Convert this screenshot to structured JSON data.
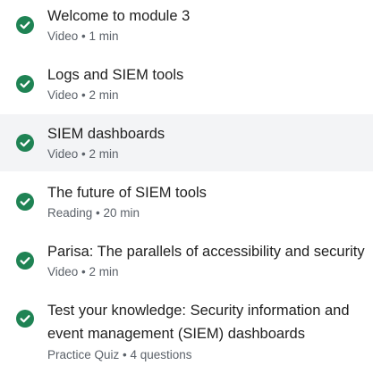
{
  "items": [
    {
      "title": "Welcome to module 3",
      "type": "Video",
      "duration": "1 min",
      "meta": "Video • 1 min",
      "completed": true,
      "active": false
    },
    {
      "title": "Logs and SIEM tools",
      "type": "Video",
      "duration": "2 min",
      "meta": "Video • 2 min",
      "completed": true,
      "active": false
    },
    {
      "title": "SIEM dashboards",
      "type": "Video",
      "duration": "2 min",
      "meta": "Video • 2 min",
      "completed": true,
      "active": true
    },
    {
      "title": "The future of SIEM tools",
      "type": "Reading",
      "duration": "20 min",
      "meta": "Reading • 20 min",
      "completed": true,
      "active": false
    },
    {
      "title": "Parisa: The parallels of accessibility and security",
      "type": "Video",
      "duration": "2 min",
      "meta": "Video • 2 min",
      "completed": true,
      "active": false
    },
    {
      "title": "Test your knowledge: Security information and event management (SIEM) dashboards",
      "type": "Practice Quiz",
      "duration": "4 questions",
      "meta": "Practice Quiz • 4 questions",
      "completed": true,
      "active": false
    }
  ],
  "colors": {
    "check_fill": "#1f8354",
    "check_mark": "#ffffff",
    "active_bg": "#f3f4f6",
    "title_text": "#1f1f1f",
    "meta_text": "#5b6169"
  },
  "icons": {
    "completed": "check-circle-icon"
  }
}
